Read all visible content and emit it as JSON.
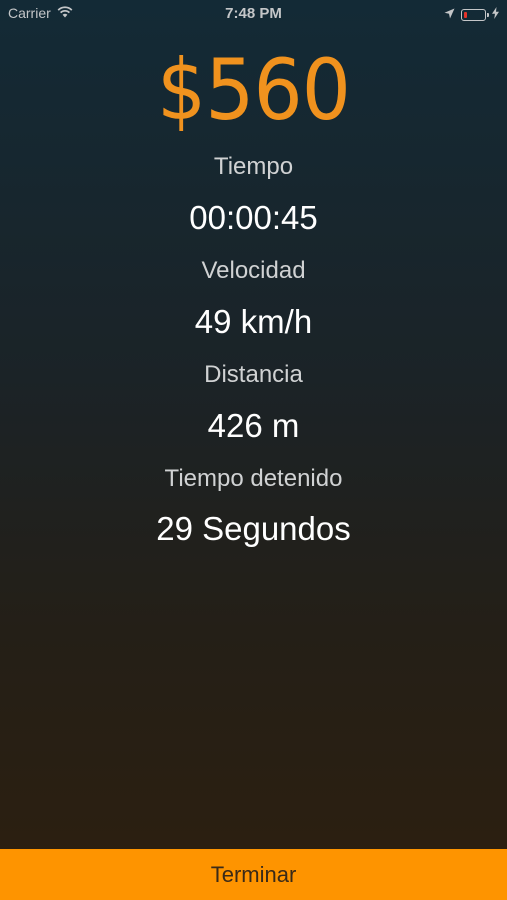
{
  "status_bar": {
    "carrier": "Carrier",
    "time": "7:48 PM"
  },
  "trip": {
    "fare": "$560",
    "time_label": "Tiempo",
    "time_value": "00:00:45",
    "speed_label": "Velocidad",
    "speed_value": "49 km/h",
    "distance_label": "Distancia",
    "distance_value": "426 m",
    "stopped_label": "Tiempo detenido",
    "stopped_value": "29 Segundos"
  },
  "actions": {
    "finish_label": "Terminar"
  },
  "colors": {
    "accent": "#fe9400",
    "fare_text": "#f0921e",
    "battery_low": "#e5332a"
  },
  "icons": [
    "wifi-icon",
    "location-arrow-icon",
    "battery-icon",
    "charging-bolt-icon"
  ]
}
